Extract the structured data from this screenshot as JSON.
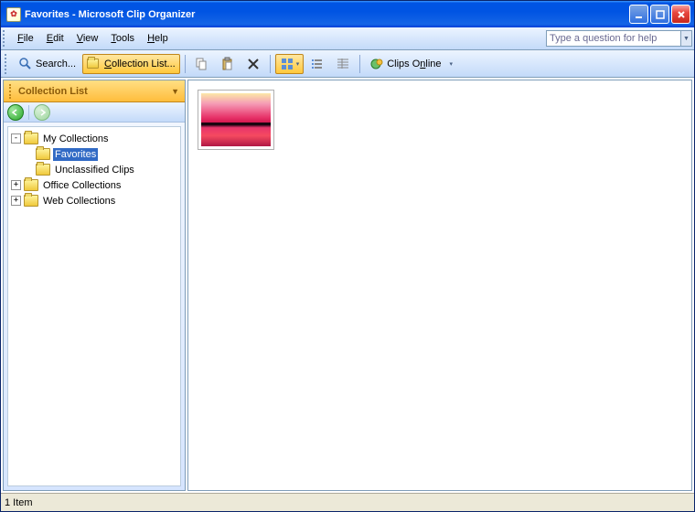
{
  "window": {
    "title": "Favorites - Microsoft Clip Organizer"
  },
  "menu": {
    "file": "File",
    "edit": "Edit",
    "view": "View",
    "tools": "Tools",
    "help": "Help",
    "help_placeholder": "Type a question for help"
  },
  "toolbar": {
    "search": "Search...",
    "collection_list": "Collection List...",
    "clips_online": "Clips Online"
  },
  "sidebar": {
    "header": "Collection List"
  },
  "tree": {
    "my_collections": "My Collections",
    "favorites": "Favorites",
    "unclassified": "Unclassified Clips",
    "office": "Office Collections",
    "web": "Web Collections"
  },
  "status": {
    "text": "1 Item"
  }
}
